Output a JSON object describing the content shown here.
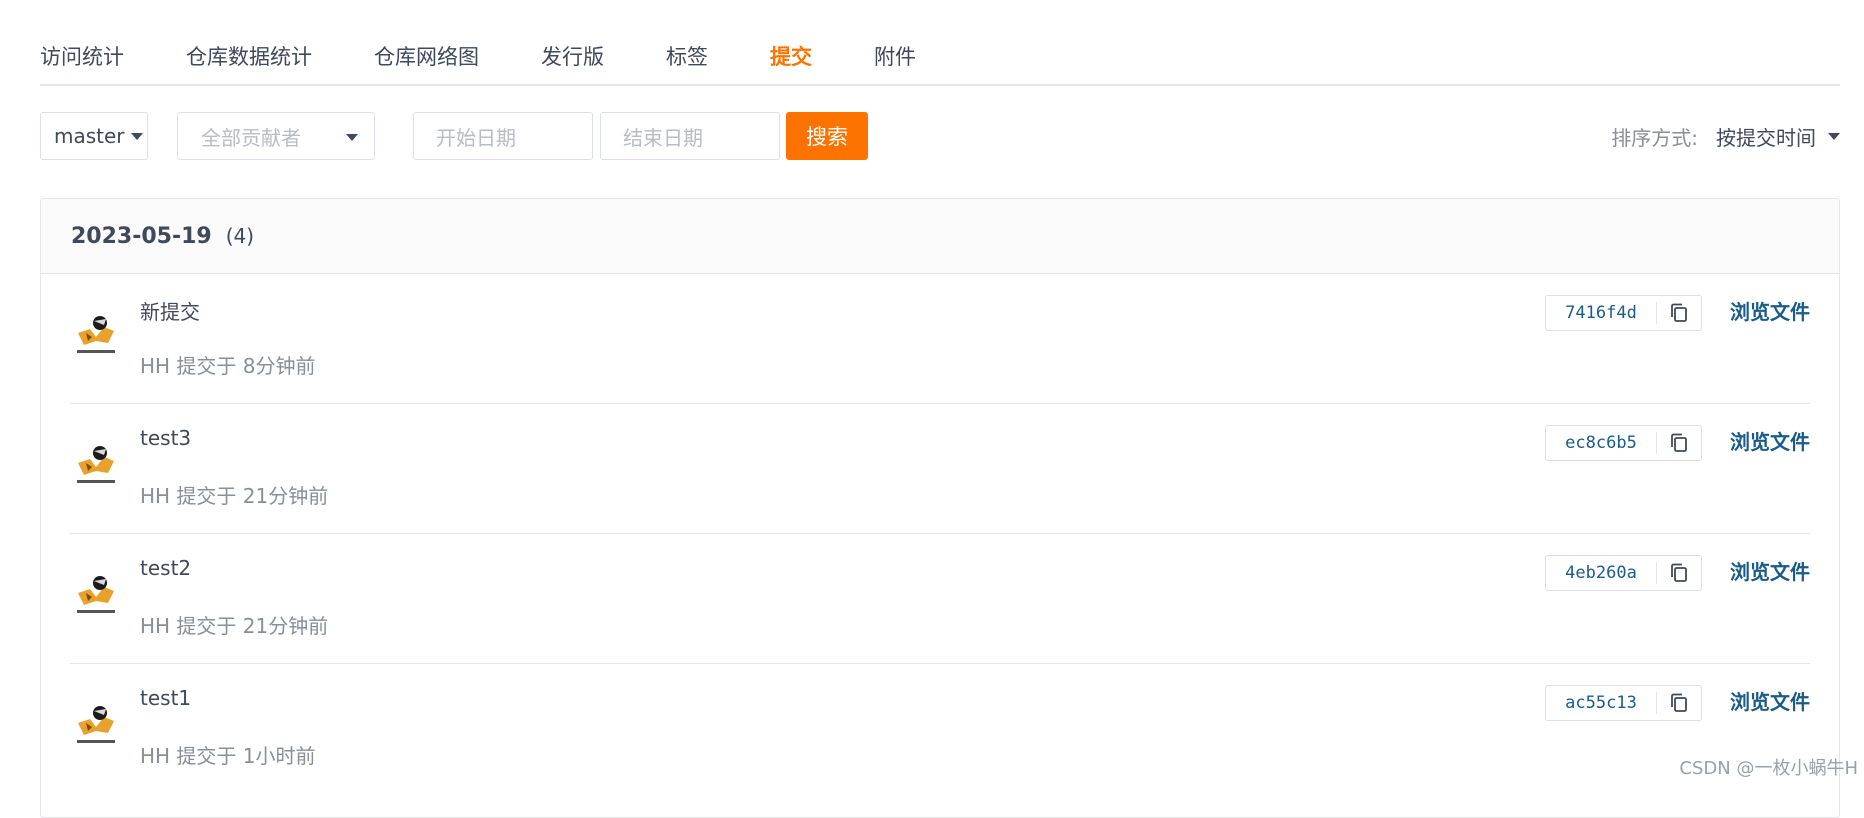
{
  "tabs": [
    {
      "label": "访问统计",
      "active": false
    },
    {
      "label": "仓库数据统计",
      "active": false
    },
    {
      "label": "仓库网络图",
      "active": false
    },
    {
      "label": "发行版",
      "active": false
    },
    {
      "label": "标签",
      "active": false
    },
    {
      "label": "提交",
      "active": true
    },
    {
      "label": "附件",
      "active": false
    }
  ],
  "filters": {
    "branch": "master",
    "contributor_placeholder": "全部贡献者",
    "start_date_placeholder": "开始日期",
    "end_date_placeholder": "结束日期",
    "search_label": "搜索",
    "sort_label": "排序方式:",
    "sort_value": "按提交时间"
  },
  "group": {
    "date": "2023-05-19",
    "count": "(4)"
  },
  "commits": [
    {
      "title": "新提交",
      "meta": "HH 提交于 8分钟前",
      "sha": "7416f4d",
      "browse_label": "浏览文件"
    },
    {
      "title": "test3",
      "meta": "HH 提交于 21分钟前",
      "sha": "ec8c6b5",
      "browse_label": "浏览文件"
    },
    {
      "title": "test2",
      "meta": "HH 提交于 21分钟前",
      "sha": "4eb260a",
      "browse_label": "浏览文件"
    },
    {
      "title": "test1",
      "meta": "HH 提交于 1小时前",
      "sha": "ac55c13",
      "browse_label": "浏览文件"
    }
  ],
  "watermark": "CSDN @一枚小蜗牛H",
  "colors": {
    "accent": "#fe7300",
    "link": "#1a5b8a",
    "text": "#40485b",
    "muted": "#8a8e99",
    "border": "#e3e5e8"
  },
  "icons": {
    "caret": "caret-down-icon",
    "copy": "copy-icon",
    "avatar": "avatar"
  }
}
